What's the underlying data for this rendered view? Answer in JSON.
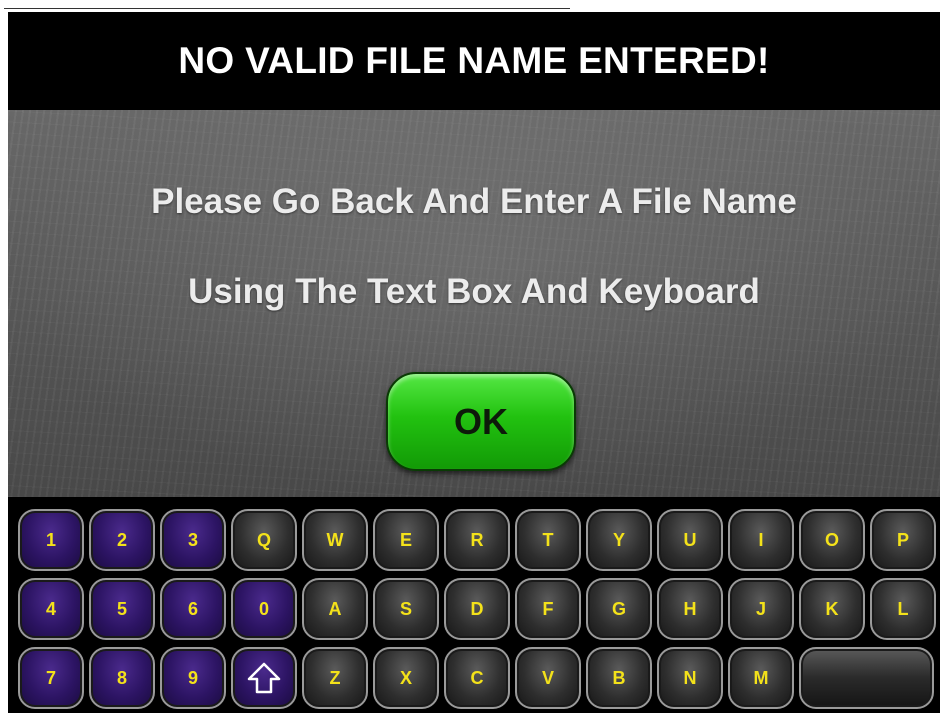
{
  "title": "NO VALID FILE NAME ENTERED!",
  "message": {
    "line1": "Please Go Back And Enter A File Name",
    "line2": "Using The Text Box And Keyboard"
  },
  "ok_button": {
    "label": "OK",
    "color": "#22c210"
  },
  "keyboard": {
    "key_text_color": "#f4e21a",
    "number_key_color": "#2c1463",
    "letter_key_color": "#2e2e2e",
    "row1": [
      "1",
      "2",
      "3",
      "Q",
      "W",
      "E",
      "R",
      "T",
      "Y",
      "U",
      "I",
      "O",
      "P"
    ],
    "row2": [
      "4",
      "5",
      "6",
      "0",
      "A",
      "S",
      "D",
      "F",
      "G",
      "H",
      "J",
      "K",
      "L"
    ],
    "row3": [
      "7",
      "8",
      "9",
      "Z",
      "X",
      "C",
      "V",
      "B",
      "N",
      "M"
    ],
    "shift_icon": "shift-arrow-icon",
    "space_icon": "blank-space-key"
  }
}
